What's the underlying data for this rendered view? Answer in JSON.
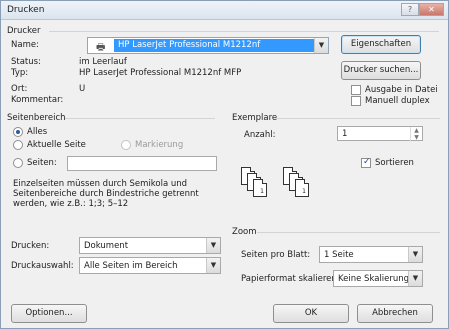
{
  "window": {
    "title": "Drucken"
  },
  "printer": {
    "section_label": "Drucker",
    "name_label": "Name:",
    "name_value": "HP LaserJet Professional M1212nf",
    "status_label": "Status:",
    "status_value": "im Leerlauf",
    "type_label": "Typ:",
    "type_value": "HP LaserJet Professional M1212nf MFP",
    "location_label": "Ort:",
    "location_value": "U",
    "comment_label": "Kommentar:",
    "comment_value": "",
    "properties_button": "Eigenschaften",
    "find_button": "Drucker suchen...",
    "print_to_file": "Ausgabe in Datei",
    "print_to_file_checked": false,
    "manual_duplex": "Manuell duplex",
    "manual_duplex_checked": false
  },
  "page_range": {
    "title": "Seitenbereich",
    "all": "Alles",
    "current": "Aktuelle Seite",
    "selection": "Markierung",
    "pages": "Seiten:",
    "pages_value": "",
    "selected": "all",
    "hint_line1": "Einzelseiten müssen durch Semikola und",
    "hint_line2": "Seitenbereiche durch Bindestriche getrennt",
    "hint_line3": "werden, wie z.B.: 1;3; 5–12"
  },
  "copies": {
    "title": "Exemplare",
    "count_label": "Anzahl:",
    "count_value": "1",
    "collate_label": "Sortieren",
    "collate_checked": true
  },
  "print_what": {
    "label": "Drucken:",
    "value": "Dokument",
    "print_selection_label": "Druckauswahl:",
    "print_selection_value": "Alle Seiten im Bereich"
  },
  "zoom": {
    "title": "Zoom",
    "pages_per_sheet_label": "Seiten pro Blatt:",
    "pages_per_sheet_value": "1 Seite",
    "scale_label": "Papierformat skalieren:",
    "scale_value": "Keine Skalierung"
  },
  "footer": {
    "options_button": "Optionen...",
    "ok_button": "OK",
    "cancel_button": "Abbrechen"
  }
}
